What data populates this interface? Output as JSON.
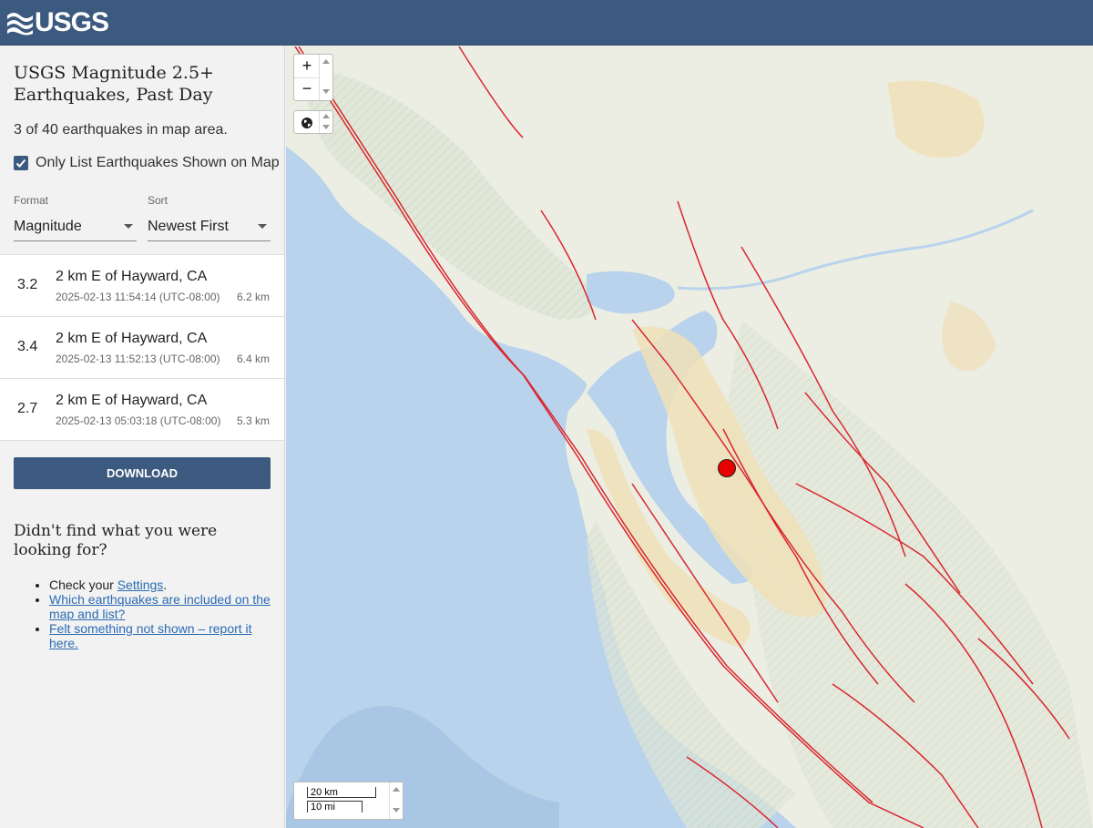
{
  "header": {
    "logo_text": "USGS"
  },
  "sidebar": {
    "title": "USGS Magnitude 2.5+ Earthquakes, Past Day",
    "count_text": "3 of 40 earthquakes in map area.",
    "only_list_label": "Only List Earthquakes Shown on Map",
    "only_list_checked": true,
    "format": {
      "label": "Format",
      "value": "Magnitude"
    },
    "sort": {
      "label": "Sort",
      "value": "Newest First"
    },
    "earthquakes": [
      {
        "mag": "3.2",
        "place": "2 km E of Hayward, CA",
        "time": "2025-02-13 11:54:14 (UTC-08:00)",
        "depth": "6.2 km"
      },
      {
        "mag": "3.4",
        "place": "2 km E of Hayward, CA",
        "time": "2025-02-13 11:52:13 (UTC-08:00)",
        "depth": "6.4 km"
      },
      {
        "mag": "2.7",
        "place": "2 km E of Hayward, CA",
        "time": "2025-02-13 05:03:18 (UTC-08:00)",
        "depth": "5.3 km"
      }
    ],
    "download_label": "DOWNLOAD",
    "help": {
      "title": "Didn't find what you were looking for?",
      "item1_prefix": "Check your ",
      "item1_link": "Settings",
      "item1_suffix": ".",
      "item2_link": "Which earthquakes are included on the map and list?",
      "item3_link": "Felt something not shown – report it here."
    }
  },
  "map": {
    "zoom_in": "+",
    "zoom_out": "−",
    "scale_km": "20 km",
    "scale_mi": "10 mi",
    "colors": {
      "ocean": "#b9d3ec",
      "land": "#eceee4",
      "urban": "#f0e0b8",
      "fault": "#d9262e",
      "quake": "#e60000"
    }
  }
}
